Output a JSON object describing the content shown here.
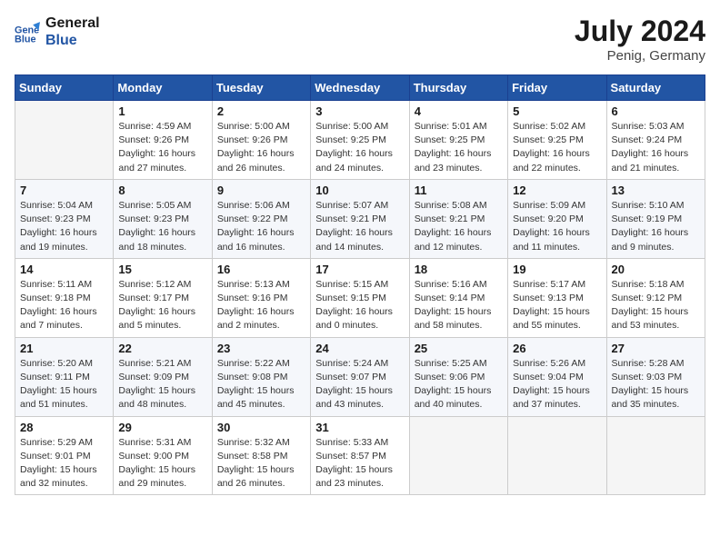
{
  "header": {
    "logo_line1": "General",
    "logo_line2": "Blue",
    "month_year": "July 2024",
    "location": "Penig, Germany"
  },
  "weekdays": [
    "Sunday",
    "Monday",
    "Tuesday",
    "Wednesday",
    "Thursday",
    "Friday",
    "Saturday"
  ],
  "weeks": [
    [
      {
        "day": "",
        "info": ""
      },
      {
        "day": "1",
        "info": "Sunrise: 4:59 AM\nSunset: 9:26 PM\nDaylight: 16 hours\nand 27 minutes."
      },
      {
        "day": "2",
        "info": "Sunrise: 5:00 AM\nSunset: 9:26 PM\nDaylight: 16 hours\nand 26 minutes."
      },
      {
        "day": "3",
        "info": "Sunrise: 5:00 AM\nSunset: 9:25 PM\nDaylight: 16 hours\nand 24 minutes."
      },
      {
        "day": "4",
        "info": "Sunrise: 5:01 AM\nSunset: 9:25 PM\nDaylight: 16 hours\nand 23 minutes."
      },
      {
        "day": "5",
        "info": "Sunrise: 5:02 AM\nSunset: 9:25 PM\nDaylight: 16 hours\nand 22 minutes."
      },
      {
        "day": "6",
        "info": "Sunrise: 5:03 AM\nSunset: 9:24 PM\nDaylight: 16 hours\nand 21 minutes."
      }
    ],
    [
      {
        "day": "7",
        "info": "Sunrise: 5:04 AM\nSunset: 9:23 PM\nDaylight: 16 hours\nand 19 minutes."
      },
      {
        "day": "8",
        "info": "Sunrise: 5:05 AM\nSunset: 9:23 PM\nDaylight: 16 hours\nand 18 minutes."
      },
      {
        "day": "9",
        "info": "Sunrise: 5:06 AM\nSunset: 9:22 PM\nDaylight: 16 hours\nand 16 minutes."
      },
      {
        "day": "10",
        "info": "Sunrise: 5:07 AM\nSunset: 9:21 PM\nDaylight: 16 hours\nand 14 minutes."
      },
      {
        "day": "11",
        "info": "Sunrise: 5:08 AM\nSunset: 9:21 PM\nDaylight: 16 hours\nand 12 minutes."
      },
      {
        "day": "12",
        "info": "Sunrise: 5:09 AM\nSunset: 9:20 PM\nDaylight: 16 hours\nand 11 minutes."
      },
      {
        "day": "13",
        "info": "Sunrise: 5:10 AM\nSunset: 9:19 PM\nDaylight: 16 hours\nand 9 minutes."
      }
    ],
    [
      {
        "day": "14",
        "info": "Sunrise: 5:11 AM\nSunset: 9:18 PM\nDaylight: 16 hours\nand 7 minutes."
      },
      {
        "day": "15",
        "info": "Sunrise: 5:12 AM\nSunset: 9:17 PM\nDaylight: 16 hours\nand 5 minutes."
      },
      {
        "day": "16",
        "info": "Sunrise: 5:13 AM\nSunset: 9:16 PM\nDaylight: 16 hours\nand 2 minutes."
      },
      {
        "day": "17",
        "info": "Sunrise: 5:15 AM\nSunset: 9:15 PM\nDaylight: 16 hours\nand 0 minutes."
      },
      {
        "day": "18",
        "info": "Sunrise: 5:16 AM\nSunset: 9:14 PM\nDaylight: 15 hours\nand 58 minutes."
      },
      {
        "day": "19",
        "info": "Sunrise: 5:17 AM\nSunset: 9:13 PM\nDaylight: 15 hours\nand 55 minutes."
      },
      {
        "day": "20",
        "info": "Sunrise: 5:18 AM\nSunset: 9:12 PM\nDaylight: 15 hours\nand 53 minutes."
      }
    ],
    [
      {
        "day": "21",
        "info": "Sunrise: 5:20 AM\nSunset: 9:11 PM\nDaylight: 15 hours\nand 51 minutes."
      },
      {
        "day": "22",
        "info": "Sunrise: 5:21 AM\nSunset: 9:09 PM\nDaylight: 15 hours\nand 48 minutes."
      },
      {
        "day": "23",
        "info": "Sunrise: 5:22 AM\nSunset: 9:08 PM\nDaylight: 15 hours\nand 45 minutes."
      },
      {
        "day": "24",
        "info": "Sunrise: 5:24 AM\nSunset: 9:07 PM\nDaylight: 15 hours\nand 43 minutes."
      },
      {
        "day": "25",
        "info": "Sunrise: 5:25 AM\nSunset: 9:06 PM\nDaylight: 15 hours\nand 40 minutes."
      },
      {
        "day": "26",
        "info": "Sunrise: 5:26 AM\nSunset: 9:04 PM\nDaylight: 15 hours\nand 37 minutes."
      },
      {
        "day": "27",
        "info": "Sunrise: 5:28 AM\nSunset: 9:03 PM\nDaylight: 15 hours\nand 35 minutes."
      }
    ],
    [
      {
        "day": "28",
        "info": "Sunrise: 5:29 AM\nSunset: 9:01 PM\nDaylight: 15 hours\nand 32 minutes."
      },
      {
        "day": "29",
        "info": "Sunrise: 5:31 AM\nSunset: 9:00 PM\nDaylight: 15 hours\nand 29 minutes."
      },
      {
        "day": "30",
        "info": "Sunrise: 5:32 AM\nSunset: 8:58 PM\nDaylight: 15 hours\nand 26 minutes."
      },
      {
        "day": "31",
        "info": "Sunrise: 5:33 AM\nSunset: 8:57 PM\nDaylight: 15 hours\nand 23 minutes."
      },
      {
        "day": "",
        "info": ""
      },
      {
        "day": "",
        "info": ""
      },
      {
        "day": "",
        "info": ""
      }
    ]
  ]
}
